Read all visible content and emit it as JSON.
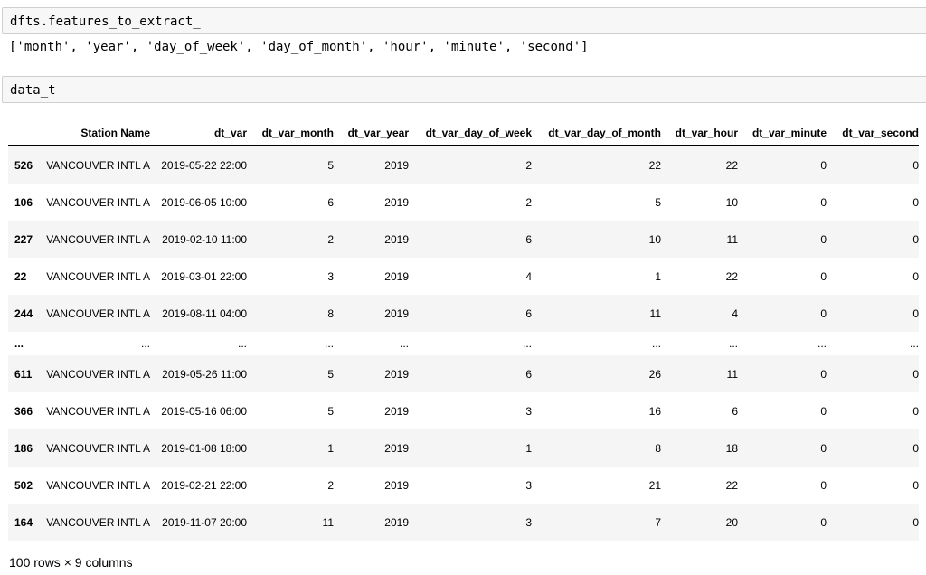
{
  "cells": [
    {
      "input": "dfts.features_to_extract_",
      "output": "['month', 'year', 'day_of_week', 'day_of_month', 'hour', 'minute', 'second']"
    },
    {
      "input": "data_t"
    }
  ],
  "table": {
    "columns": [
      "",
      "Station Name",
      "dt_var",
      "dt_var_month",
      "dt_var_year",
      "dt_var_day_of_week",
      "dt_var_day_of_month",
      "dt_var_hour",
      "dt_var_minute",
      "dt_var_second"
    ],
    "rows": [
      [
        "526",
        "VANCOUVER INTL A",
        "2019-05-22 22:00",
        "5",
        "2019",
        "2",
        "22",
        "22",
        "0",
        "0"
      ],
      [
        "106",
        "VANCOUVER INTL A",
        "2019-06-05 10:00",
        "6",
        "2019",
        "2",
        "5",
        "10",
        "0",
        "0"
      ],
      [
        "227",
        "VANCOUVER INTL A",
        "2019-02-10 11:00",
        "2",
        "2019",
        "6",
        "10",
        "11",
        "0",
        "0"
      ],
      [
        "22",
        "VANCOUVER INTL A",
        "2019-03-01 22:00",
        "3",
        "2019",
        "4",
        "1",
        "22",
        "0",
        "0"
      ],
      [
        "244",
        "VANCOUVER INTL A",
        "2019-08-11 04:00",
        "8",
        "2019",
        "6",
        "11",
        "4",
        "0",
        "0"
      ],
      [
        "...",
        "...",
        "...",
        "...",
        "...",
        "...",
        "...",
        "...",
        "...",
        "..."
      ],
      [
        "611",
        "VANCOUVER INTL A",
        "2019-05-26 11:00",
        "5",
        "2019",
        "6",
        "26",
        "11",
        "0",
        "0"
      ],
      [
        "366",
        "VANCOUVER INTL A",
        "2019-05-16 06:00",
        "5",
        "2019",
        "3",
        "16",
        "6",
        "0",
        "0"
      ],
      [
        "186",
        "VANCOUVER INTL A",
        "2019-01-08 18:00",
        "1",
        "2019",
        "1",
        "8",
        "18",
        "0",
        "0"
      ],
      [
        "502",
        "VANCOUVER INTL A",
        "2019-02-21 22:00",
        "2",
        "2019",
        "3",
        "21",
        "22",
        "0",
        "0"
      ],
      [
        "164",
        "VANCOUVER INTL A",
        "2019-11-07 20:00",
        "11",
        "2019",
        "3",
        "7",
        "20",
        "0",
        "0"
      ]
    ],
    "shape": "100 rows × 9 columns"
  }
}
